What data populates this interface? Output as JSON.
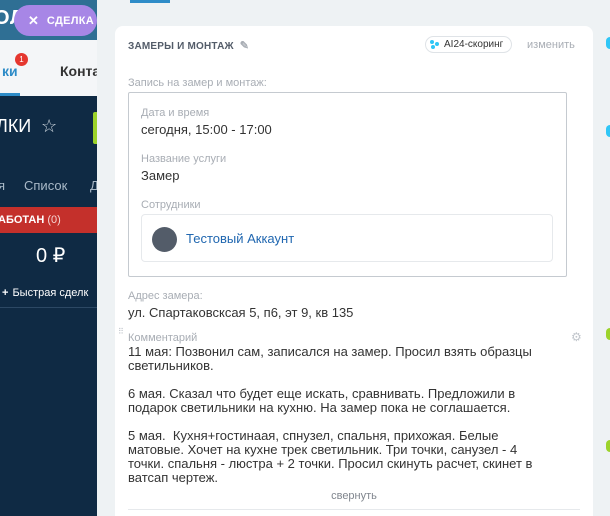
{
  "background": {
    "header_text": "ОЛ",
    "tabs": [
      {
        "label": "ки",
        "badge": "1",
        "active": true
      },
      {
        "label": "Конта",
        "active": false
      }
    ],
    "title": "ЛКИ",
    "views": [
      "я",
      "Список",
      "Д"
    ],
    "stage": {
      "name": "АБОТАН",
      "count": "(0)",
      "amount": "0 ₽"
    },
    "quick_deal_label": "Быстрая сделк"
  },
  "close_chip": {
    "label": "СДЕЛКА",
    "icon": "close-icon"
  },
  "section": {
    "title": "ЗАМЕРЫ И МОНТАЖ",
    "scoring_label": "AI24-скоринг",
    "change_label": "изменить",
    "record_label": "Запись на замер и монтаж:",
    "datetime_label": "Дата и время",
    "datetime_value": "сегодня, 15:00 - 17:00",
    "service_label": "Название услуги",
    "service_value": "Замер",
    "employees_label": "Сотрудники",
    "employee_name": "Тестовый Аккаунт",
    "address_label": "Адрес замера:",
    "address_value": "ул. Спартаковсксая 5, п6, эт 9, кв 135",
    "comment_label": "Комментарий",
    "comment_text": "11 мая: Позвонил сам, записался на замер. Просил взять образцы светильников.\n\n6 мая. Сказал что будет еще искать, сравнивать. Предложили в подарок светильники на кухню. На замер пока не соглашается.\n\n5 мая.  Кухня+гостинаая, спнузел, спальня, прихожая. Белые матовые. Хочет на кухне трек светильник. Три точки, санузел - 4 точки. спальня - люстра + 2 точки. Просил скинуть расчет, скинет в ватсап чертеж.",
    "collapse_label": "свернуть"
  },
  "colors": {
    "accent": "#2e8cc8",
    "chip": "#a786e6",
    "stage": "#c4302b",
    "link": "#2067b0"
  }
}
